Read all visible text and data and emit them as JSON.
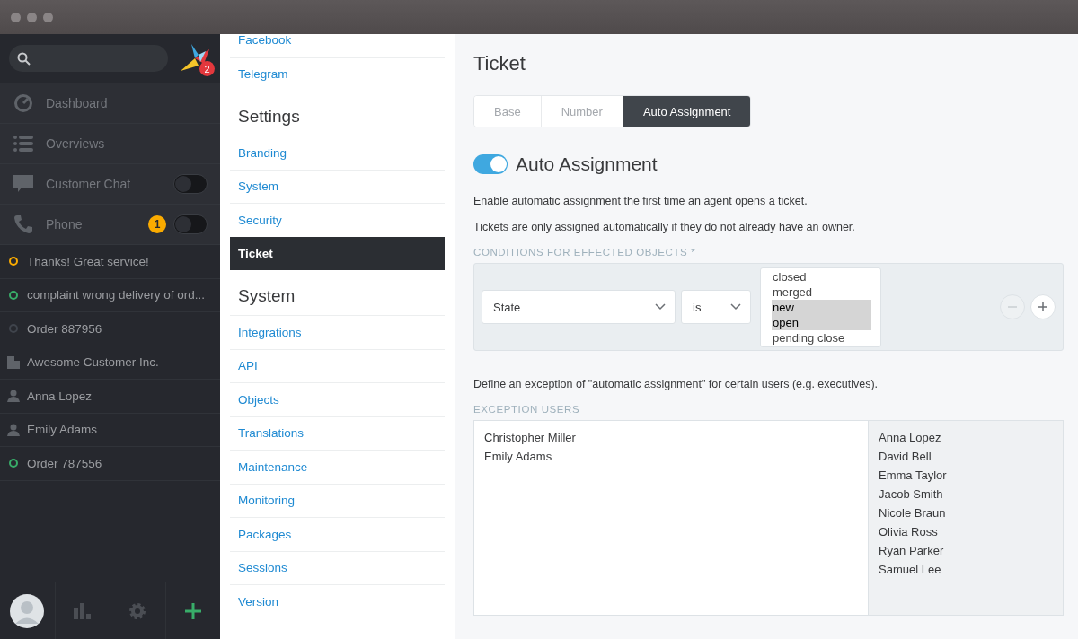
{
  "sidebar": {
    "logo_badge": "2",
    "nav": [
      {
        "label": "Dashboard",
        "kind": "dashboard"
      },
      {
        "label": "Overviews",
        "kind": "overviews"
      },
      {
        "label": "Customer Chat",
        "kind": "chat",
        "toggle": {
          "on": false
        }
      },
      {
        "label": "Phone",
        "kind": "phone",
        "badge": "1",
        "toggle": {
          "on": false
        }
      }
    ],
    "recent": [
      {
        "label": "Thanks! Great service!",
        "kind": "status",
        "color": "#faab00"
      },
      {
        "label": "complaint wrong delivery of ord...",
        "kind": "status",
        "color": "#38ad69"
      },
      {
        "label": "Order 887956",
        "kind": "status",
        "color": "#3f444c"
      },
      {
        "label": "Awesome Customer Inc.",
        "kind": "organization"
      },
      {
        "label": "Anna Lopez",
        "kind": "person"
      },
      {
        "label": "Emily Adams",
        "kind": "person"
      },
      {
        "label": "Order 787556",
        "kind": "status",
        "color": "#38ad69"
      }
    ]
  },
  "settings_nav": [
    {
      "items": [
        {
          "label": "Facebook",
          "selected": false
        },
        {
          "label": "Telegram",
          "selected": false
        }
      ]
    },
    {
      "heading": "Settings",
      "items": [
        {
          "label": "Branding",
          "selected": false
        },
        {
          "label": "System",
          "selected": false
        },
        {
          "label": "Security",
          "selected": false
        },
        {
          "label": "Ticket",
          "selected": true
        }
      ]
    },
    {
      "heading": "System",
      "items": [
        {
          "label": "Integrations",
          "selected": false
        },
        {
          "label": "API",
          "selected": false
        },
        {
          "label": "Objects",
          "selected": false
        },
        {
          "label": "Translations",
          "selected": false
        },
        {
          "label": "Maintenance",
          "selected": false
        },
        {
          "label": "Monitoring",
          "selected": false
        },
        {
          "label": "Packages",
          "selected": false
        },
        {
          "label": "Sessions",
          "selected": false
        },
        {
          "label": "Version",
          "selected": false
        }
      ]
    }
  ],
  "content": {
    "title": "Ticket",
    "tabs": [
      {
        "label": "Base",
        "selected": false
      },
      {
        "label": "Number",
        "selected": false
      },
      {
        "label": "Auto Assignment",
        "selected": true
      }
    ],
    "setting": {
      "label": "Auto Assignment",
      "on": true
    },
    "paragraphs": [
      "Enable automatic assignment the first time an agent opens a ticket.",
      "Tickets are only assigned automatically if they do not already have an owner."
    ],
    "conditions_label": "CONDITIONS FOR EFFECTED OBJECTS *",
    "condition": {
      "attribute": "State",
      "operator": "is",
      "values": [
        {
          "label": "closed",
          "selected": false
        },
        {
          "label": "merged",
          "selected": false
        },
        {
          "label": "new",
          "selected": true
        },
        {
          "label": "open",
          "selected": true
        },
        {
          "label": "pending close",
          "selected": false
        }
      ]
    },
    "exception_text": "Define an exception of \"automatic assignment\" for certain users (e.g. executives).",
    "exception_label": "EXCEPTION USERS",
    "selected_users": [
      "Christopher Miller",
      "Emily Adams"
    ],
    "available_users": [
      "Anna Lopez",
      "David Bell",
      "Emma Taylor",
      "Jacob Smith",
      "Nicole Braun",
      "Olivia Ross",
      "Ryan Parker",
      "Samuel Lee"
    ]
  }
}
